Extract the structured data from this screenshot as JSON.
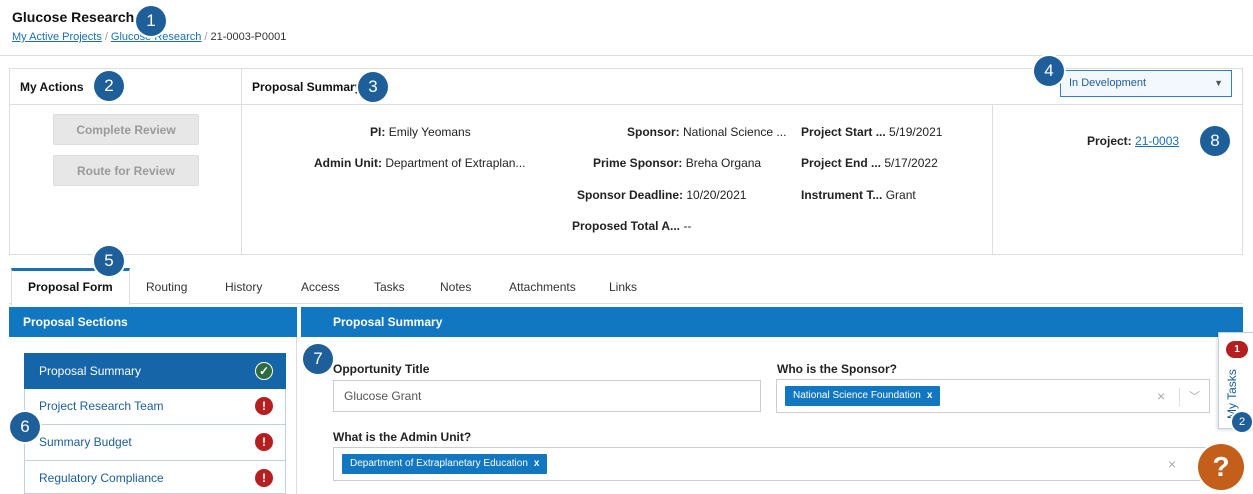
{
  "header": {
    "title": "Glucose Research",
    "breadcrumb": [
      "My Active Projects",
      "Glucose Research",
      "21-0003-P0001"
    ]
  },
  "callouts": [
    "1",
    "2",
    "3",
    "4",
    "5",
    "6",
    "7",
    "8",
    "2"
  ],
  "actions": {
    "heading": "My Actions",
    "buttons": [
      "Complete Review",
      "Route for Review"
    ]
  },
  "summary": {
    "heading": "Proposal Summary",
    "status": "In Development",
    "fields": {
      "pi_label": "PI:",
      "pi": "Emily Yeomans",
      "admin_label": "Admin Unit:",
      "admin": "Department of Extraplan...",
      "sponsor_label": "Sponsor:",
      "sponsor": "National Science ...",
      "prime_label": "Prime Sponsor:",
      "prime": "Breha Organa",
      "deadline_label": "Sponsor Deadline:",
      "deadline": "10/20/2021",
      "total_label": "Proposed Total A...",
      "total": "--",
      "start_label": "Project Start ...",
      "start": "5/19/2021",
      "end_label": "Project End ...",
      "end": "5/17/2022",
      "instrument_label": "Instrument T...",
      "instrument": "Grant"
    },
    "project_label": "Project:",
    "project_link": "21-0003"
  },
  "tabs": [
    "Proposal Form",
    "Routing",
    "History",
    "Access",
    "Tasks",
    "Notes",
    "Attachments",
    "Links"
  ],
  "sections": {
    "heading": "Proposal Sections",
    "items": [
      {
        "label": "Proposal Summary",
        "status": "✓"
      },
      {
        "label": "Project Research Team",
        "status": "!"
      },
      {
        "label": "Summary Budget",
        "status": "!"
      },
      {
        "label": "Regulatory Compliance",
        "status": "!"
      }
    ]
  },
  "form": {
    "heading": "Proposal Summary",
    "opportunity_label": "Opportunity Title",
    "opportunity_value": "Glucose Grant",
    "sponsor_label": "Who is the Sponsor?",
    "sponsor_chip": "National Science Foundation",
    "admin_label": "What is the Admin Unit?",
    "admin_chip": "Department of Extraplanetary Education",
    "chip_remove": "x",
    "clear": "×",
    "chevron": "﹀"
  },
  "my_tasks": {
    "label": "My Tasks",
    "count": "1"
  },
  "help": {
    "label": "?"
  },
  "colors": {
    "primary": "#1277c1",
    "error": "#b51f1f",
    "success": "#2e6b3e",
    "help": "#c35f1b"
  }
}
